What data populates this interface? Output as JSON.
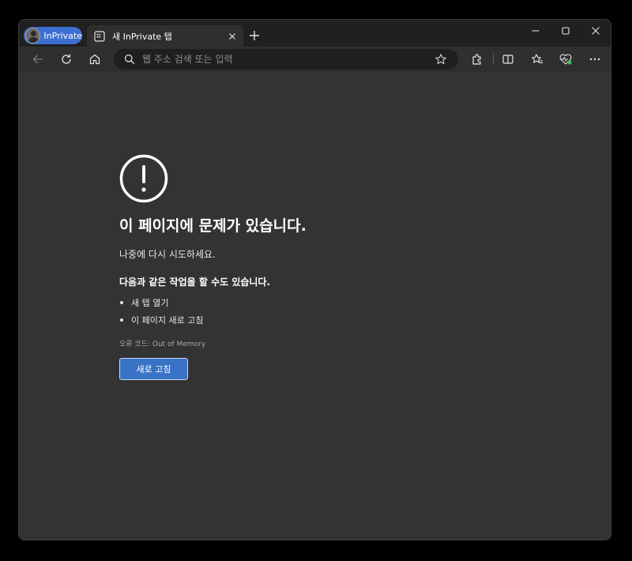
{
  "titlebar": {
    "profile_label": "InPrivate",
    "tab_title": "새 InPrivate 탭",
    "window_controls": [
      "minimize-icon",
      "maximize-icon",
      "close-icon"
    ]
  },
  "toolbar": {
    "address_placeholder": "웹 주소 검색 또는 입력",
    "left_icons": [
      "back-arrow-icon",
      "refresh-icon",
      "home-icon"
    ],
    "right_icons": [
      "extensions-icon",
      "split-screen-icon",
      "favorites-icon",
      "browser-essentials-icon",
      "more-icon"
    ]
  },
  "error_page": {
    "title": "이 페이지에 문제가 있습니다.",
    "subtitle": "나중에 다시 시도하세요.",
    "options_title": "다음과 같은 작업을 할 수도 있습니다.",
    "options": [
      "새 탭 열기",
      "이 페이지 새로 고침"
    ],
    "error_code": "오류 코드: Out of Memory",
    "reload_label": "새로 고침"
  },
  "colors": {
    "accent": "#3873c6",
    "content_bg": "#333333",
    "toolbar_bg": "#2f2f2f",
    "titlebar_bg": "#202020",
    "heartbeat_green": "#3fbf5f"
  }
}
